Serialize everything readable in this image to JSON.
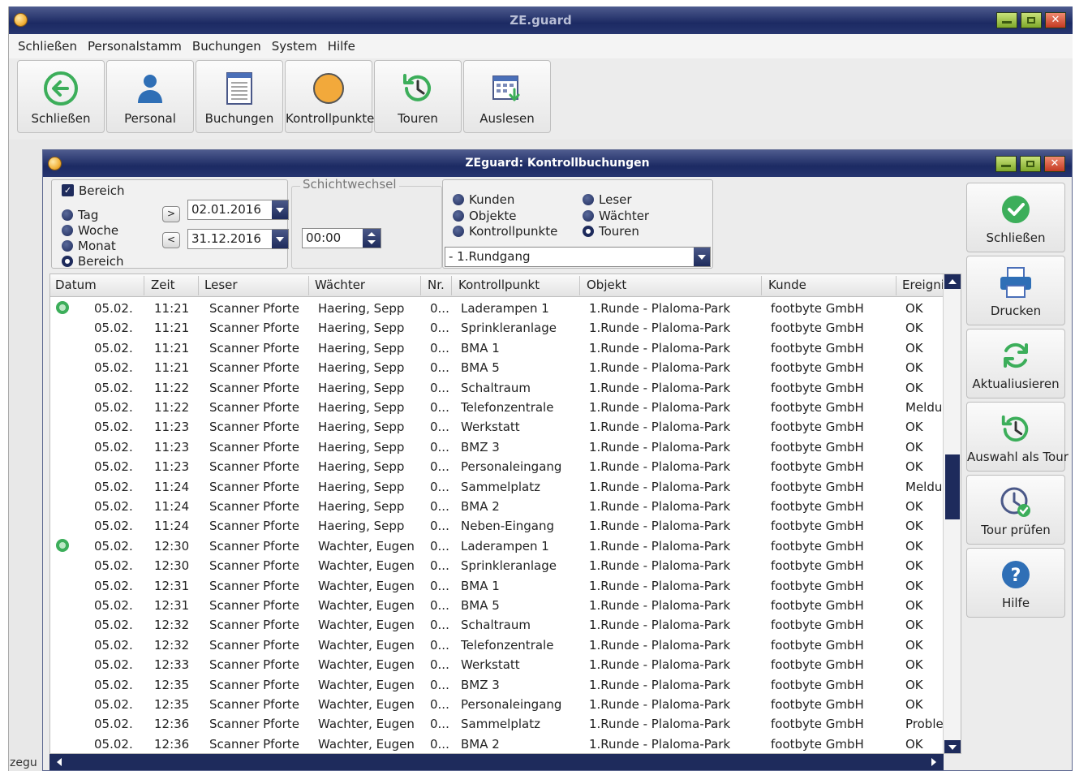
{
  "app": {
    "title": "ZE.guard"
  },
  "menu": [
    "Schließen",
    "Personalstamm",
    "Buchungen",
    "System",
    "Hilfe"
  ],
  "toolbar": {
    "close": "Schließen",
    "personal": "Personal",
    "bookings": "Buchungen",
    "checkpoints": "Kontrollpunkte",
    "tours": "Touren",
    "read": "Auslesen"
  },
  "inner": {
    "title": "ZEguard: Kontrollbuchungen"
  },
  "range_group": {
    "checkbox_label": "Bereich",
    "radios": [
      "Tag",
      "Woche",
      "Monat",
      "Bereich"
    ],
    "selected": "Bereich",
    "date_from": "02.01.2016",
    "date_to": "31.12.2016"
  },
  "shift": {
    "legend": "Schichtwechsel",
    "time": "00:00"
  },
  "type_group": {
    "left": [
      "Kunden",
      "Objekte",
      "Kontrollpunkte"
    ],
    "right": [
      "Leser",
      "Wächter",
      "Touren"
    ],
    "selected": "Touren",
    "select_value": "- 1.Rundgang"
  },
  "table": {
    "headers": [
      "Datum",
      "Zeit",
      "Leser",
      "Wächter",
      "Nr.",
      "Kontrollpunkt",
      "Objekt",
      "Kunde",
      "Ereigni"
    ],
    "rows": [
      {
        "icon": true,
        "date": "05.02.",
        "time": "11:21",
        "reader": "Scanner Pforte",
        "guard": "Haering, Sepp",
        "nr": "0...",
        "point": "Laderampen 1",
        "object": "1.Runde - Plaloma-Park",
        "customer": "footbyte GmbH",
        "event": "OK"
      },
      {
        "icon": false,
        "date": "05.02.",
        "time": "11:21",
        "reader": "Scanner Pforte",
        "guard": "Haering, Sepp",
        "nr": "0...",
        "point": "Sprinkleranlage",
        "object": "1.Runde - Plaloma-Park",
        "customer": "footbyte GmbH",
        "event": "OK"
      },
      {
        "icon": false,
        "date": "05.02.",
        "time": "11:21",
        "reader": "Scanner Pforte",
        "guard": "Haering, Sepp",
        "nr": "0...",
        "point": "BMA 1",
        "object": "1.Runde - Plaloma-Park",
        "customer": "footbyte GmbH",
        "event": "OK"
      },
      {
        "icon": false,
        "date": "05.02.",
        "time": "11:21",
        "reader": "Scanner Pforte",
        "guard": "Haering, Sepp",
        "nr": "0...",
        "point": "BMA 5",
        "object": "1.Runde - Plaloma-Park",
        "customer": "footbyte GmbH",
        "event": "OK"
      },
      {
        "icon": false,
        "date": "05.02.",
        "time": "11:22",
        "reader": "Scanner Pforte",
        "guard": "Haering, Sepp",
        "nr": "0...",
        "point": "Schaltraum",
        "object": "1.Runde - Plaloma-Park",
        "customer": "footbyte GmbH",
        "event": "OK"
      },
      {
        "icon": false,
        "date": "05.02.",
        "time": "11:22",
        "reader": "Scanner Pforte",
        "guard": "Haering, Sepp",
        "nr": "0...",
        "point": "Telefonzentrale",
        "object": "1.Runde - Plaloma-Park",
        "customer": "footbyte GmbH",
        "event": "Meldu"
      },
      {
        "icon": false,
        "date": "05.02.",
        "time": "11:23",
        "reader": "Scanner Pforte",
        "guard": "Haering, Sepp",
        "nr": "0...",
        "point": "Werkstatt",
        "object": "1.Runde - Plaloma-Park",
        "customer": "footbyte GmbH",
        "event": "OK"
      },
      {
        "icon": false,
        "date": "05.02.",
        "time": "11:23",
        "reader": "Scanner Pforte",
        "guard": "Haering, Sepp",
        "nr": "0...",
        "point": "BMZ 3",
        "object": "1.Runde - Plaloma-Park",
        "customer": "footbyte GmbH",
        "event": "OK"
      },
      {
        "icon": false,
        "date": "05.02.",
        "time": "11:23",
        "reader": "Scanner Pforte",
        "guard": "Haering, Sepp",
        "nr": "0...",
        "point": "Personaleingang",
        "object": "1.Runde - Plaloma-Park",
        "customer": "footbyte GmbH",
        "event": "OK"
      },
      {
        "icon": false,
        "date": "05.02.",
        "time": "11:24",
        "reader": "Scanner Pforte",
        "guard": "Haering, Sepp",
        "nr": "0...",
        "point": "Sammelplatz",
        "object": "1.Runde - Plaloma-Park",
        "customer": "footbyte GmbH",
        "event": "Meldu"
      },
      {
        "icon": false,
        "date": "05.02.",
        "time": "11:24",
        "reader": "Scanner Pforte",
        "guard": "Haering, Sepp",
        "nr": "0...",
        "point": "BMA 2",
        "object": "1.Runde - Plaloma-Park",
        "customer": "footbyte GmbH",
        "event": "OK"
      },
      {
        "icon": false,
        "date": "05.02.",
        "time": "11:24",
        "reader": "Scanner Pforte",
        "guard": "Haering, Sepp",
        "nr": "0...",
        "point": "Neben-Eingang",
        "object": "1.Runde - Plaloma-Park",
        "customer": "footbyte GmbH",
        "event": "OK"
      },
      {
        "icon": true,
        "date": "05.02.",
        "time": "12:30",
        "reader": "Scanner Pforte",
        "guard": "Wachter, Eugen",
        "nr": "0...",
        "point": "Laderampen 1",
        "object": "1.Runde - Plaloma-Park",
        "customer": "footbyte GmbH",
        "event": "OK"
      },
      {
        "icon": false,
        "date": "05.02.",
        "time": "12:30",
        "reader": "Scanner Pforte",
        "guard": "Wachter, Eugen",
        "nr": "0...",
        "point": "Sprinkleranlage",
        "object": "1.Runde - Plaloma-Park",
        "customer": "footbyte GmbH",
        "event": "OK"
      },
      {
        "icon": false,
        "date": "05.02.",
        "time": "12:31",
        "reader": "Scanner Pforte",
        "guard": "Wachter, Eugen",
        "nr": "0...",
        "point": "BMA 1",
        "object": "1.Runde - Plaloma-Park",
        "customer": "footbyte GmbH",
        "event": "OK"
      },
      {
        "icon": false,
        "date": "05.02.",
        "time": "12:31",
        "reader": "Scanner Pforte",
        "guard": "Wachter, Eugen",
        "nr": "0...",
        "point": "BMA 5",
        "object": "1.Runde - Plaloma-Park",
        "customer": "footbyte GmbH",
        "event": "OK"
      },
      {
        "icon": false,
        "date": "05.02.",
        "time": "12:32",
        "reader": "Scanner Pforte",
        "guard": "Wachter, Eugen",
        "nr": "0...",
        "point": "Schaltraum",
        "object": "1.Runde - Plaloma-Park",
        "customer": "footbyte GmbH",
        "event": "OK"
      },
      {
        "icon": false,
        "date": "05.02.",
        "time": "12:32",
        "reader": "Scanner Pforte",
        "guard": "Wachter, Eugen",
        "nr": "0...",
        "point": "Telefonzentrale",
        "object": "1.Runde - Plaloma-Park",
        "customer": "footbyte GmbH",
        "event": "OK"
      },
      {
        "icon": false,
        "date": "05.02.",
        "time": "12:33",
        "reader": "Scanner Pforte",
        "guard": "Wachter, Eugen",
        "nr": "0...",
        "point": "Werkstatt",
        "object": "1.Runde - Plaloma-Park",
        "customer": "footbyte GmbH",
        "event": "OK"
      },
      {
        "icon": false,
        "date": "05.02.",
        "time": "12:35",
        "reader": "Scanner Pforte",
        "guard": "Wachter, Eugen",
        "nr": "0...",
        "point": "BMZ 3",
        "object": "1.Runde - Plaloma-Park",
        "customer": "footbyte GmbH",
        "event": "OK"
      },
      {
        "icon": false,
        "date": "05.02.",
        "time": "12:35",
        "reader": "Scanner Pforte",
        "guard": "Wachter, Eugen",
        "nr": "0...",
        "point": "Personaleingang",
        "object": "1.Runde - Plaloma-Park",
        "customer": "footbyte GmbH",
        "event": "OK"
      },
      {
        "icon": false,
        "date": "05.02.",
        "time": "12:36",
        "reader": "Scanner Pforte",
        "guard": "Wachter, Eugen",
        "nr": "0...",
        "point": "Sammelplatz",
        "object": "1.Runde - Plaloma-Park",
        "customer": "footbyte GmbH",
        "event": "Proble"
      },
      {
        "icon": false,
        "date": "05.02.",
        "time": "12:36",
        "reader": "Scanner Pforte",
        "guard": "Wachter, Eugen",
        "nr": "0...",
        "point": "BMA 2",
        "object": "1.Runde - Plaloma-Park",
        "customer": "footbyte GmbH",
        "event": "OK"
      }
    ]
  },
  "side_buttons": {
    "close": "Schließen",
    "print": "Drucken",
    "refresh": "Aktualiusieren",
    "as_tour": "Auswahl als Tour",
    "check_tour": "Tour prüfen",
    "help": "Hilfe"
  },
  "status": {
    "text": "zegu"
  },
  "colors": {
    "accent": "#1e2b5c",
    "ok_green": "#3cae5a",
    "orange": "#f2a93b"
  }
}
